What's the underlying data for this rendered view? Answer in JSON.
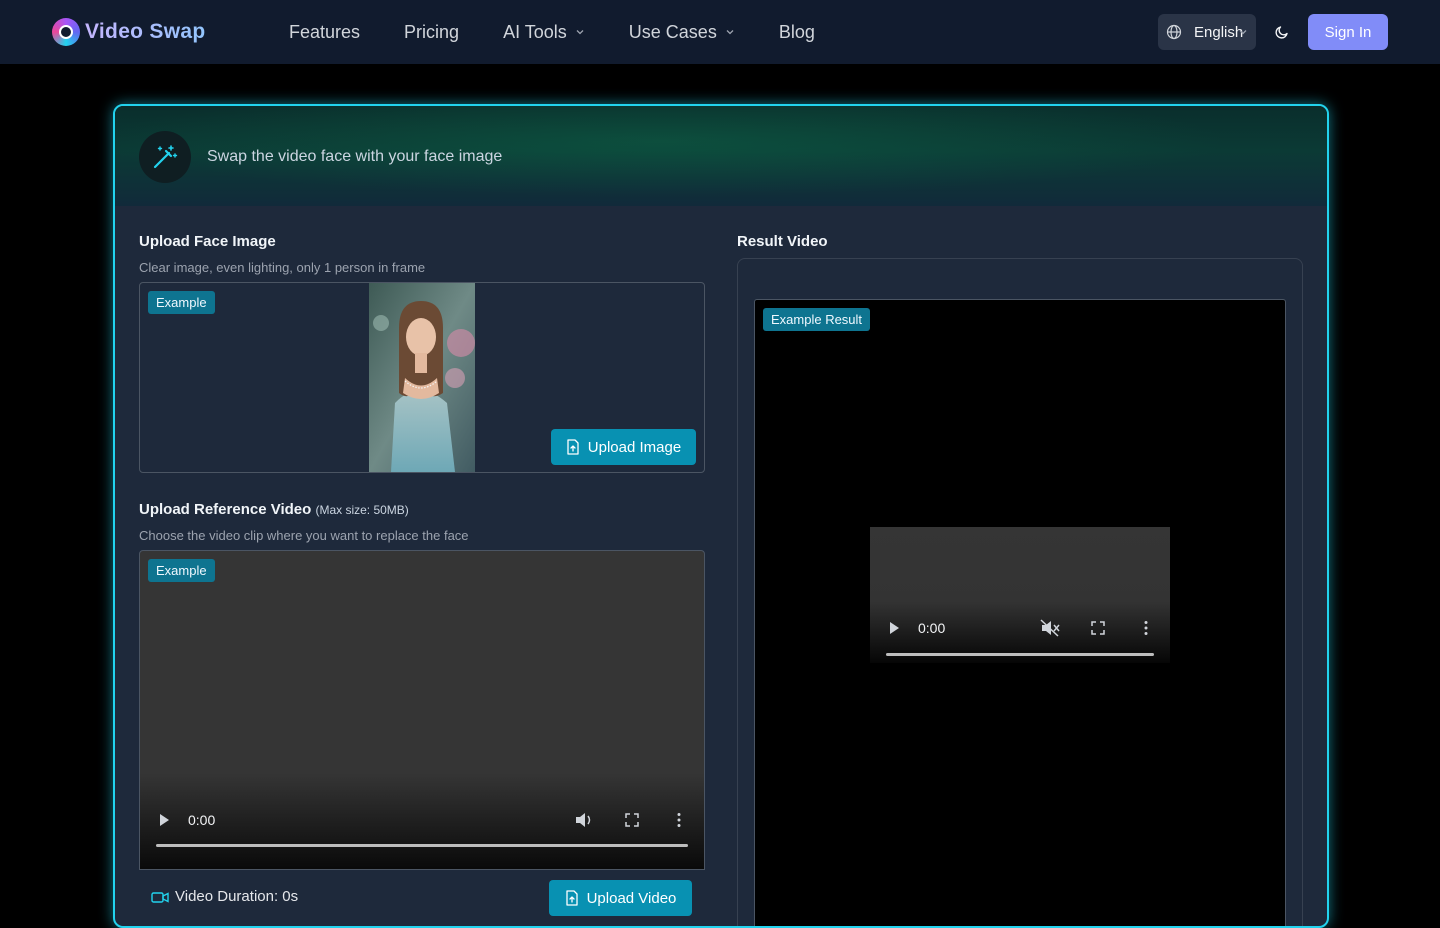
{
  "header": {
    "logo_text": "Video Swap",
    "nav": [
      {
        "label": "Features",
        "has_dropdown": false
      },
      {
        "label": "Pricing",
        "has_dropdown": false
      },
      {
        "label": "AI Tools",
        "has_dropdown": true
      },
      {
        "label": "Use Cases",
        "has_dropdown": true
      },
      {
        "label": "Blog",
        "has_dropdown": false
      }
    ],
    "language": "English",
    "sign_in": "Sign In"
  },
  "card": {
    "subtitle": "Swap the video face with your face image",
    "face": {
      "title": "Upload Face Image",
      "hint": "Clear image, even lighting, only 1 person in frame",
      "badge": "Example",
      "upload_button": "Upload Image"
    },
    "video": {
      "title": "Upload Reference Video",
      "max_size": "(Max size: 50MB)",
      "hint": "Choose the video clip where you want to replace the face",
      "badge": "Example",
      "time": "0:00",
      "duration_label": "Video Duration: 0s",
      "upload_button": "Upload Video"
    },
    "result": {
      "title": "Result Video",
      "badge": "Example Result",
      "time": "0:00"
    }
  },
  "colors": {
    "accent": "#22d3ee",
    "button": "#0891b2",
    "sign_in": "#818cf8"
  }
}
